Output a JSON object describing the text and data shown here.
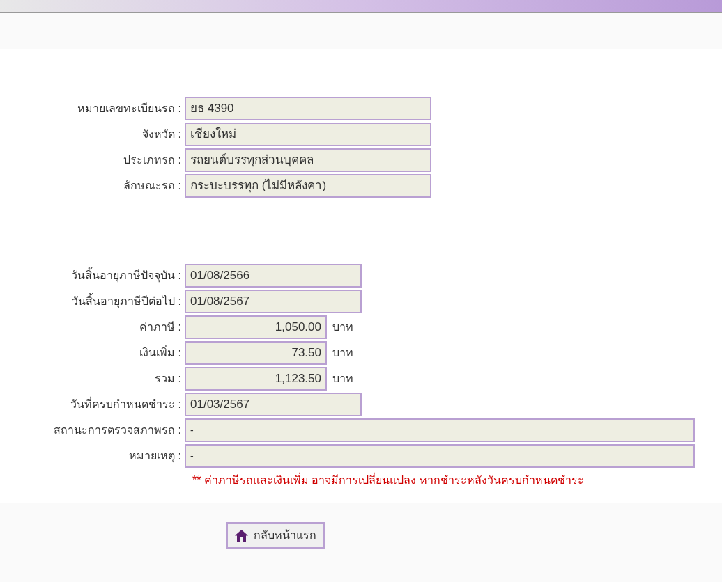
{
  "vehicle": [
    {
      "label": "หมายเลขทะเบียนรถ :",
      "value": "ยธ 4390",
      "kind": "text"
    },
    {
      "label": "จังหวัด :",
      "value": "เชียงใหม่",
      "kind": "text"
    },
    {
      "label": "ประเภทรถ :",
      "value": "รถยนต์บรรทุกส่วนบุคคล",
      "kind": "text"
    },
    {
      "label": "ลักษณะรถ :",
      "value": "กระบะบรรทุก (ไม่มีหลังคา)",
      "kind": "text"
    }
  ],
  "tax": [
    {
      "label": "วันสิ้นอายุภาษีปัจจุบัน :",
      "value": "01/08/2566",
      "kind": "date"
    },
    {
      "label": "วันสิ้นอายุภาษีปีต่อไป :",
      "value": "01/08/2567",
      "kind": "date"
    },
    {
      "label": "ค่าภาษี :",
      "value": "1,050.00",
      "kind": "money",
      "unit": "บาท"
    },
    {
      "label": "เงินเพิ่ม :",
      "value": "73.50",
      "kind": "money",
      "unit": "บาท"
    },
    {
      "label": "รวม :",
      "value": "1,123.50",
      "kind": "money",
      "unit": "บาท"
    },
    {
      "label": "วันที่ครบกำหนดชำระ :",
      "value": "01/03/2567",
      "kind": "date"
    },
    {
      "label": "สถานะการตรวจสภาพรถ :",
      "value": "-",
      "kind": "wide"
    },
    {
      "label": "หมายเหตุ :",
      "value": "-",
      "kind": "wide"
    }
  ],
  "note": "** ค่าภาษีรถและเงินเพิ่ม อาจมีการเปลี่ยนแปลง หากชำระหลังวันครบกำหนดชำระ",
  "home_button": "กลับหน้าแรก"
}
